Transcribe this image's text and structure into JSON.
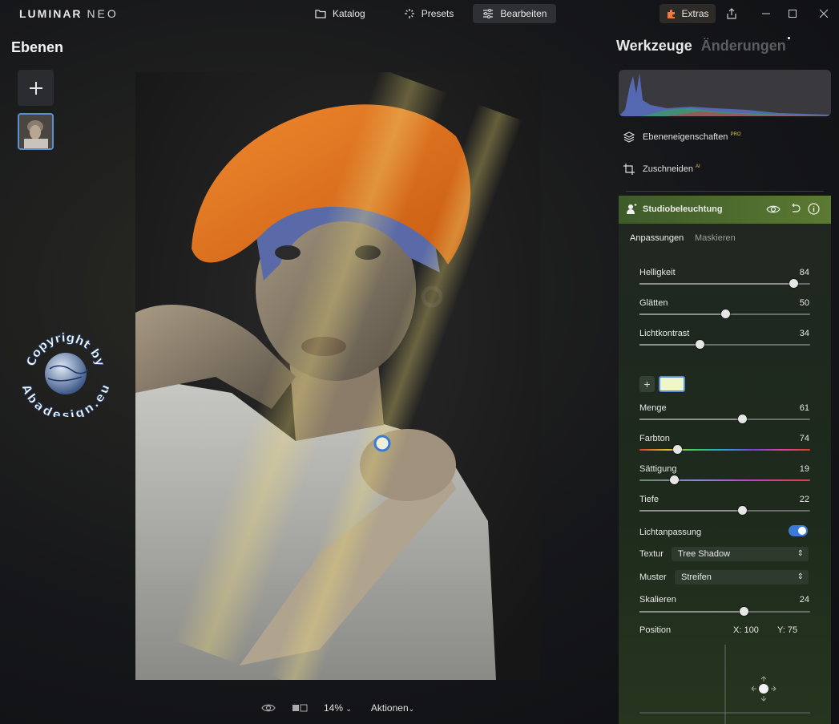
{
  "app": {
    "logo_main": "LUMINAR",
    "logo_sub": "NEO",
    "nav": {
      "katalog": "Katalog",
      "presets": "Presets",
      "bearbeiten": "Bearbeiten",
      "active": "Bearbeiten"
    },
    "extras_label": "Extras"
  },
  "layers_panel": {
    "title": "Ebenen"
  },
  "watermark": {
    "line1": "Copyright by",
    "line2": "Abadesign.eu"
  },
  "bottombar": {
    "zoom": "14%",
    "actions": "Aktionen"
  },
  "tools_panel": {
    "tab_active": "Werkzeuge",
    "tab_inactive": "Änderungen",
    "layer_props": "Ebeneneigenschaften",
    "layer_props_badge": "PRO",
    "crop": "Zuschneiden",
    "crop_badge": "AI",
    "studio": {
      "title": "Studiobeleuchtung",
      "subtab_active": "Anpassungen",
      "subtab_inactive": "Maskieren",
      "sliders": [
        {
          "label": "Helligkeit",
          "value": 84,
          "fraction": 0.9
        },
        {
          "label": "Glätten",
          "value": 50,
          "fraction": 0.5
        },
        {
          "label": "Lichtkontrast",
          "value": 34,
          "fraction": 0.35
        },
        {
          "label": "Menge",
          "value": 61,
          "fraction": 0.6
        },
        {
          "label": "Farbton",
          "value": 74,
          "fraction": 0.22
        },
        {
          "label": "Sättigung",
          "value": 19,
          "fraction": 0.2
        },
        {
          "label": "Tiefe",
          "value": 22,
          "fraction": 0.6
        },
        {
          "label": "Skalieren",
          "value": 24,
          "fraction": 0.61
        }
      ],
      "light_adjust_label": "Lichtanpassung",
      "light_adjust_on": true,
      "texture_label": "Textur",
      "texture_value": "Tree Shadow",
      "pattern_label": "Muster",
      "pattern_value": "Streifen",
      "position_label": "Position",
      "pos_x_label": "X:",
      "pos_x_value": "100",
      "pos_y_label": "Y:",
      "pos_y_value": "75",
      "swatch_color": "#f0f6c8"
    }
  },
  "colors": {
    "accent": "#3b7bd8",
    "studio_header": "#5b7a32",
    "badge": "#e3c64a"
  }
}
